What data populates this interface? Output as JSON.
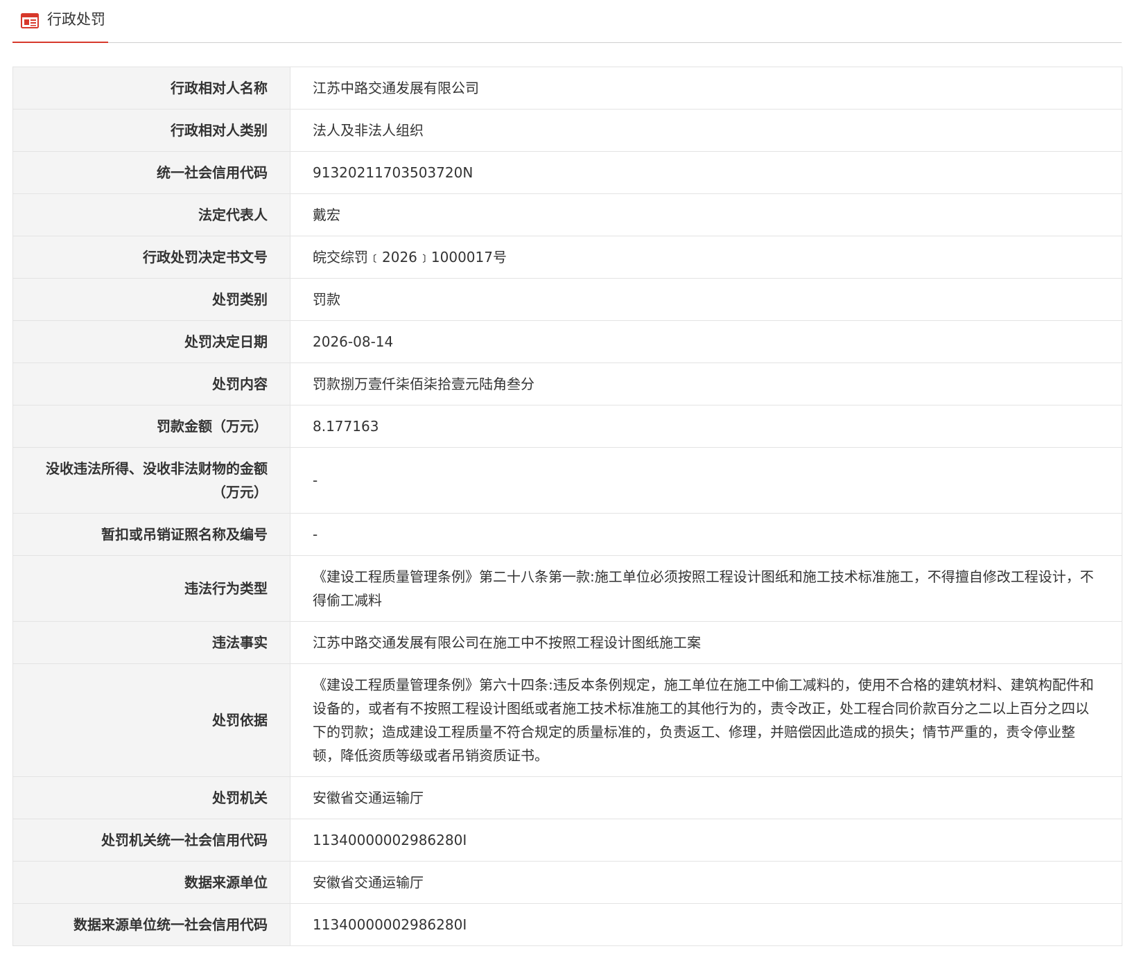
{
  "header": {
    "title": "行政处罚",
    "icon": "document-list-icon",
    "accent_color": "#d7382b"
  },
  "rows": [
    {
      "label": "行政相对人名称",
      "value": "江苏中路交通发展有限公司"
    },
    {
      "label": "行政相对人类别",
      "value": "法人及非法人组织"
    },
    {
      "label": "统一社会信用代码",
      "value": "91320211703503720N"
    },
    {
      "label": "法定代表人",
      "value": "戴宏"
    },
    {
      "label": "行政处罚决定书文号",
      "value": "皖交综罚﹝2026﹞1000017号"
    },
    {
      "label": "处罚类别",
      "value": "罚款"
    },
    {
      "label": "处罚决定日期",
      "value": "2026-08-14"
    },
    {
      "label": "处罚内容",
      "value": "罚款捌万壹仟柒佰柒拾壹元陆角叁分"
    },
    {
      "label": "罚款金额（万元）",
      "value": "8.177163"
    },
    {
      "label": "没收违法所得、没收非法财物的金额（万元）",
      "value": "-"
    },
    {
      "label": "暂扣或吊销证照名称及编号",
      "value": "-"
    },
    {
      "label": "违法行为类型",
      "value": "《建设工程质量管理条例》第二十八条第一款:施工单位必须按照工程设计图纸和施工技术标准施工，不得擅自修改工程设计，不得偷工减料"
    },
    {
      "label": "违法事实",
      "value": "江苏中路交通发展有限公司在施工中不按照工程设计图纸施工案"
    },
    {
      "label": "处罚依据",
      "value": "《建设工程质量管理条例》第六十四条:违反本条例规定，施工单位在施工中偷工减料的，使用不合格的建筑材料、建筑构配件和设备的，或者有不按照工程设计图纸或者施工技术标准施工的其他行为的，责令改正，处工程合同价款百分之二以上百分之四以下的罚款；造成建设工程质量不符合规定的质量标准的，负责返工、修理，并赔偿因此造成的损失；情节严重的，责令停业整顿，降低资质等级或者吊销资质证书。"
    },
    {
      "label": "处罚机关",
      "value": "安徽省交通运输厅"
    },
    {
      "label": "处罚机关统一社会信用代码",
      "value": "11340000002986280I"
    },
    {
      "label": "数据来源单位",
      "value": "安徽省交通运输厅"
    },
    {
      "label": "数据来源单位统一社会信用代码",
      "value": "11340000002986280I"
    }
  ]
}
